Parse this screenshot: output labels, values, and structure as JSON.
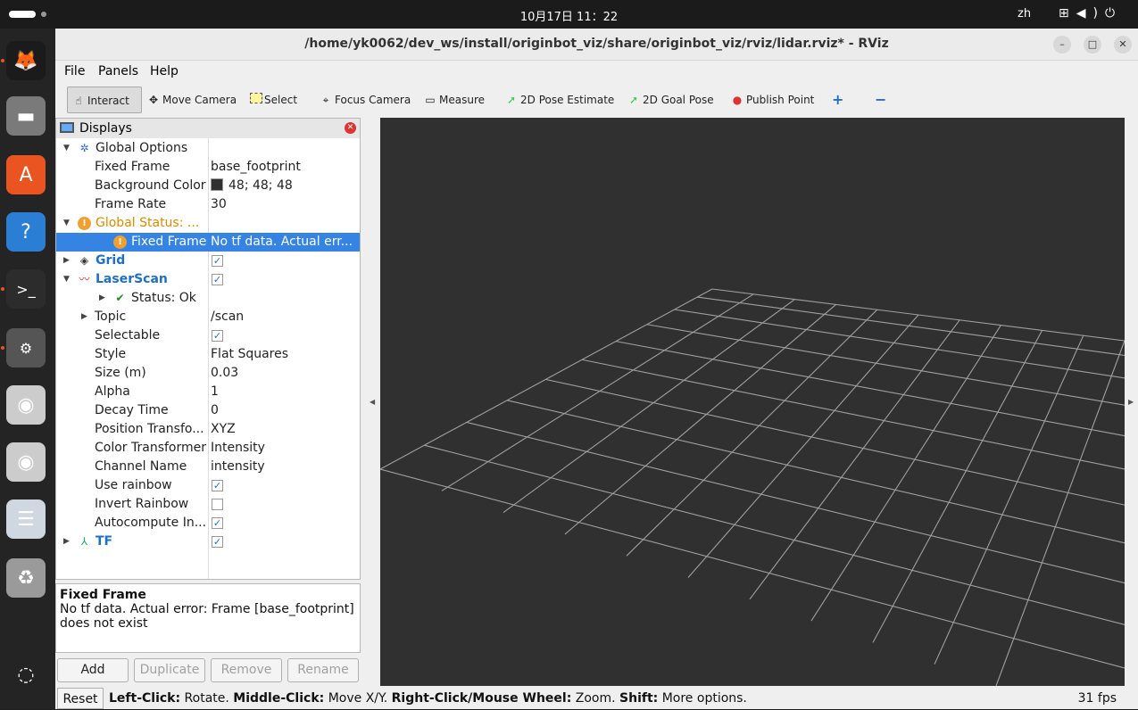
{
  "system": {
    "clock": "10月17日  11：22",
    "lang": "zh",
    "tray_icons": [
      "network-icon",
      "volume-icon",
      "power-icon"
    ]
  },
  "dock": {
    "items": [
      {
        "name": "firefox",
        "glyph": "🦊",
        "bg": "#1b1b1b"
      },
      {
        "name": "files",
        "glyph": "▬",
        "bg": "#7a7a7a"
      },
      {
        "name": "app-center",
        "glyph": "A",
        "bg": "#e95420"
      },
      {
        "name": "help",
        "glyph": "?",
        "bg": "#2a7fd4"
      },
      {
        "name": "terminal",
        "glyph": ">_",
        "bg": "#2c2c2c"
      },
      {
        "name": "settings",
        "glyph": "⚙",
        "bg": "#555555"
      },
      {
        "name": "disc-1",
        "glyph": "◉",
        "bg": "#cccccc"
      },
      {
        "name": "disc-2",
        "glyph": "◉",
        "bg": "#cccccc"
      },
      {
        "name": "document-viewer",
        "glyph": "☰",
        "bg": "#cfd8e0"
      },
      {
        "name": "trash",
        "glyph": "♻",
        "bg": "#9a9a9a"
      },
      {
        "name": "ubuntu-apps",
        "glyph": "◌",
        "bg": "#242424"
      }
    ]
  },
  "window": {
    "title": "/home/yk0062/dev_ws/install/originbot_viz/share/originbot_viz/rviz/lidar.rviz* - RViz",
    "controls": {
      "minimize": "–",
      "maximize": "□",
      "close": "✕"
    }
  },
  "menu": {
    "file": "File",
    "panels": "Panels",
    "help": "Help"
  },
  "toolbar": {
    "interact": "Interact",
    "move_camera": "Move Camera",
    "select": "Select",
    "focus_camera": "Focus Camera",
    "measure": "Measure",
    "pose_estimate": "2D Pose Estimate",
    "goal_pose": "2D Goal Pose",
    "publish_point": "Publish Point",
    "add_tool": "+",
    "remove_tool": "−"
  },
  "displays": {
    "title": "Displays",
    "rows": [
      {
        "label": "Global Options",
        "value": "",
        "indent": 0,
        "arrow": "▼",
        "icon": "gear",
        "style": ""
      },
      {
        "label": "Fixed Frame",
        "value": "base_footprint",
        "indent": 1,
        "style": ""
      },
      {
        "label": "Background Color",
        "value": "48; 48; 48",
        "indent": 1,
        "swatch": true,
        "style": ""
      },
      {
        "label": "Frame Rate",
        "value": "30",
        "indent": 1,
        "style": ""
      },
      {
        "label": "Global Status: ...",
        "value": "",
        "indent": 0,
        "arrow": "▼",
        "icon": "warn",
        "style": "orange"
      },
      {
        "label": "Fixed Frame",
        "value": "No tf data.  Actual err...",
        "indent": 2,
        "icon": "warn",
        "style": "sel"
      },
      {
        "label": "Grid",
        "value": "",
        "indent": 0,
        "arrow": "▶",
        "icon": "grid",
        "check": true,
        "style": "blue"
      },
      {
        "label": "LaserScan",
        "value": "",
        "indent": 0,
        "arrow": "▼",
        "icon": "laser",
        "check": true,
        "style": "blue"
      },
      {
        "label": "Status: Ok",
        "value": "",
        "indent": 2,
        "arrow": "▶",
        "icon": "ok",
        "style": ""
      },
      {
        "label": "Topic",
        "value": "/scan",
        "indent": 1,
        "arrow": "▶",
        "style": ""
      },
      {
        "label": "Selectable",
        "value": "",
        "indent": 1,
        "check": true,
        "style": ""
      },
      {
        "label": "Style",
        "value": "Flat Squares",
        "indent": 1,
        "style": ""
      },
      {
        "label": "Size (m)",
        "value": "0.03",
        "indent": 1,
        "style": ""
      },
      {
        "label": "Alpha",
        "value": "1",
        "indent": 1,
        "style": ""
      },
      {
        "label": "Decay Time",
        "value": "0",
        "indent": 1,
        "style": ""
      },
      {
        "label": "Position Transfo...",
        "value": "XYZ",
        "indent": 1,
        "style": ""
      },
      {
        "label": "Color Transformer",
        "value": "Intensity",
        "indent": 1,
        "style": ""
      },
      {
        "label": "Channel Name",
        "value": "intensity",
        "indent": 1,
        "style": ""
      },
      {
        "label": "Use rainbow",
        "value": "",
        "indent": 1,
        "check": true,
        "style": ""
      },
      {
        "label": "Invert Rainbow",
        "value": "",
        "indent": 1,
        "check": false,
        "style": ""
      },
      {
        "label": "Autocompute In...",
        "value": "",
        "indent": 1,
        "check": true,
        "style": ""
      },
      {
        "label": "TF",
        "value": "",
        "indent": 0,
        "arrow": "▶",
        "icon": "tf",
        "check": true,
        "style": "blue"
      }
    ]
  },
  "description": {
    "title": "Fixed Frame",
    "text": "No tf data. Actual error: Frame [base_footprint] does not exist"
  },
  "panel_buttons": {
    "add": "Add",
    "duplicate": "Duplicate",
    "remove": "Remove",
    "rename": "Rename"
  },
  "status": {
    "reset": "Reset",
    "hint_left_key": "Left-Click:",
    "hint_left": " Rotate. ",
    "hint_middle_key": "Middle-Click:",
    "hint_middle": " Move X/Y. ",
    "hint_right_key": "Right-Click/Mouse Wheel:",
    "hint_right": " Zoom. ",
    "hint_shift_key": "Shift:",
    "hint_shift": " More options.",
    "fps": "31 fps"
  },
  "colors": {
    "background": "#303030",
    "grid": "#a0a0a0",
    "selection": "#3584e4",
    "accent": "#e95420"
  }
}
